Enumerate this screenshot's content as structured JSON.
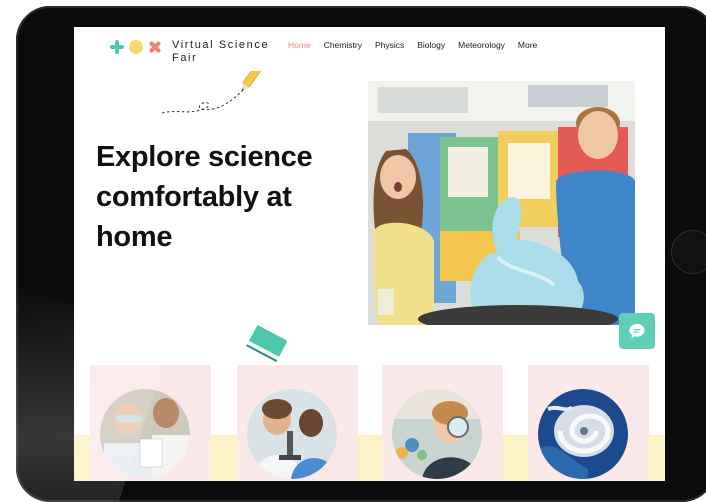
{
  "app": {
    "name": "Virtual Science Fair",
    "logo_icons": [
      "plus-icon",
      "circle-icon",
      "x-icon"
    ]
  },
  "nav": {
    "items": [
      {
        "label": "Home",
        "active": true
      },
      {
        "label": "Chemistry",
        "active": false
      },
      {
        "label": "Physics",
        "active": false
      },
      {
        "label": "Biology",
        "active": false
      },
      {
        "label": "Meteorology",
        "active": false
      },
      {
        "label": "More",
        "active": false
      }
    ]
  },
  "hero": {
    "title": "Explore science comfortably at home",
    "image": "kids-science-experiment-photo"
  },
  "cards": [
    {
      "image": "students-with-goggles-photo"
    },
    {
      "image": "kids-microscope-photo"
    },
    {
      "image": "girl-magnifying-glass-photo"
    },
    {
      "image": "hurricane-satellite-photo"
    }
  ],
  "chat": {
    "icon": "chat-icon"
  },
  "colors": {
    "accent_teal": "#5fd0b7",
    "accent_yellow": "#f7d974",
    "accent_coral": "#f27f74",
    "nav_active": "#ee8a7c",
    "card_bg": "#fbe9ea",
    "band_yellow": "#fbf3c6"
  }
}
